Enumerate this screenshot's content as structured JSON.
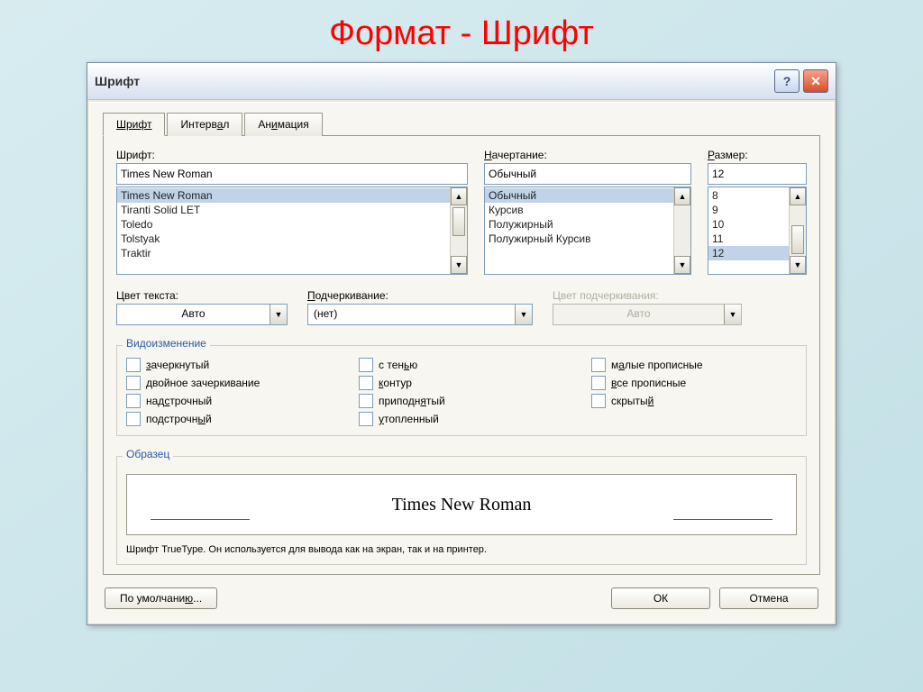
{
  "pageTitle": "Формат - Шрифт",
  "dialog": {
    "title": "Шрифт",
    "tabs": [
      "Шрифт",
      "Интервал",
      "Анимация"
    ],
    "activeTab": 0
  },
  "font": {
    "label": "Шрифт:",
    "value": "Times New Roman",
    "options": [
      "Times New Roman",
      "Tiranti Solid LET",
      "Toledo",
      "Tolstyak",
      "Traktir"
    ]
  },
  "style": {
    "label": "Начертание:",
    "value": "Обычный",
    "options": [
      "Обычный",
      "Курсив",
      "Полужирный",
      "Полужирный Курсив"
    ]
  },
  "size": {
    "label": "Размер:",
    "value": "12",
    "options": [
      "8",
      "9",
      "10",
      "11",
      "12"
    ]
  },
  "textColor": {
    "label": "Цвет текста:",
    "value": "Авто"
  },
  "underline": {
    "label": "Подчеркивание:",
    "value": "(нет)"
  },
  "underlineColor": {
    "label": "Цвет подчеркивания:",
    "value": "Авто"
  },
  "effects": {
    "legend": "Видоизменение",
    "col1": [
      "зачеркнутый",
      "двойное зачеркивание",
      "надстрочный",
      "подстрочный"
    ],
    "col2": [
      "с тенью",
      "контур",
      "приподнятый",
      "утопленный"
    ],
    "col3": [
      "малые прописные",
      "все прописные",
      "скрытый"
    ]
  },
  "preview": {
    "legend": "Образец",
    "text": "Times New Roman"
  },
  "hint": "Шрифт TrueType. Он используется для вывода как на экран, так и на принтер.",
  "buttons": {
    "default": "По умолчанию...",
    "ok": "ОК",
    "cancel": "Отмена"
  }
}
